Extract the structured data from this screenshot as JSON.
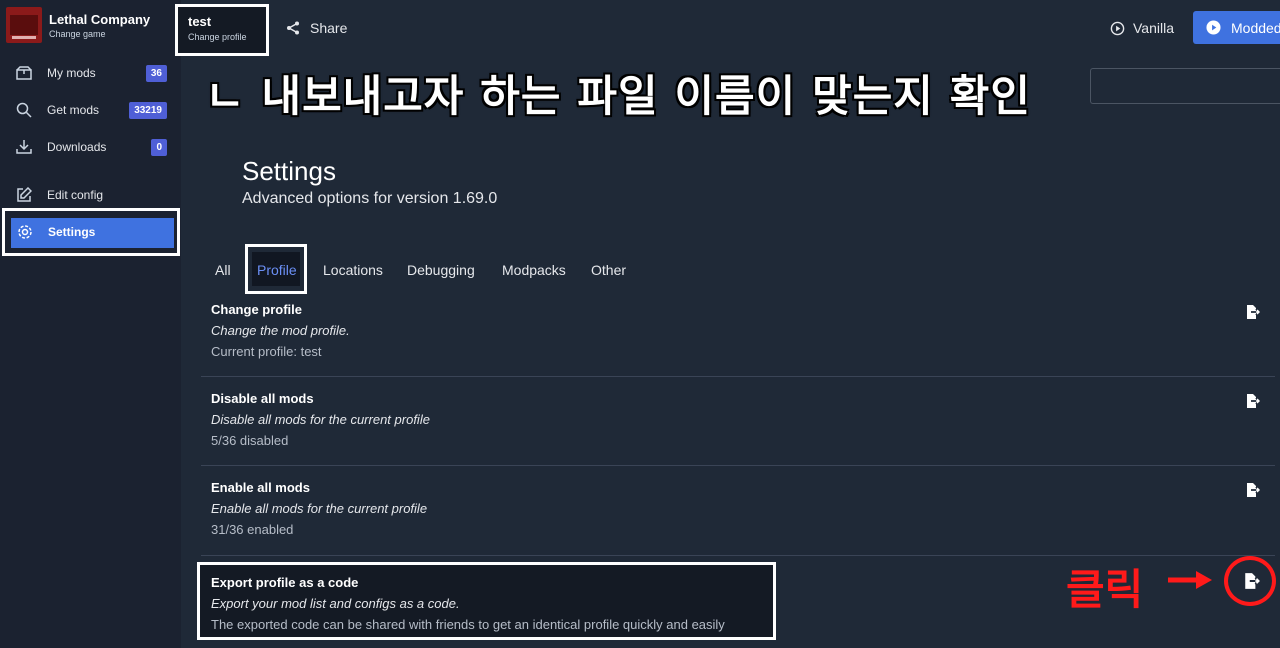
{
  "game": {
    "title": "Lethal Company",
    "subtitle": "Change game"
  },
  "sidebar": {
    "items": [
      {
        "label": "My mods",
        "badge": "36"
      },
      {
        "label": "Get mods",
        "badge": "33219"
      },
      {
        "label": "Downloads",
        "badge": "0"
      },
      {
        "label": "Edit config"
      },
      {
        "label": "Settings"
      }
    ]
  },
  "topbar": {
    "profile_name": "test",
    "profile_sub": "Change profile",
    "share": "Share",
    "vanilla": "Vanilla",
    "modded": "Modded"
  },
  "overlay": {
    "caption": "ㄴ 내보내고자 하는 파일 이름이 맞는지 확인",
    "click": "클릭"
  },
  "settings": {
    "title": "Settings",
    "subtitle": "Advanced options for version 1.69.0"
  },
  "tabs": [
    "All",
    "Profile",
    "Locations",
    "Debugging",
    "Modpacks",
    "Other"
  ],
  "rows": [
    {
      "title": "Change profile",
      "desc": "Change the mod profile.",
      "value": "Current profile: test"
    },
    {
      "title": "Disable all mods",
      "desc": "Disable all mods for the current profile",
      "value": "5/36 disabled"
    },
    {
      "title": "Enable all mods",
      "desc": "Enable all mods for the current profile",
      "value": "31/36 enabled"
    },
    {
      "title": "Export profile as a code",
      "desc": "Export your mod list and configs as a code.",
      "value": "The exported code can be shared with friends to get an identical profile quickly and easily"
    }
  ],
  "colors": {
    "accent": "#3f72e0",
    "badge": "#4f5fd6",
    "annotation": "#ff1a1a"
  }
}
